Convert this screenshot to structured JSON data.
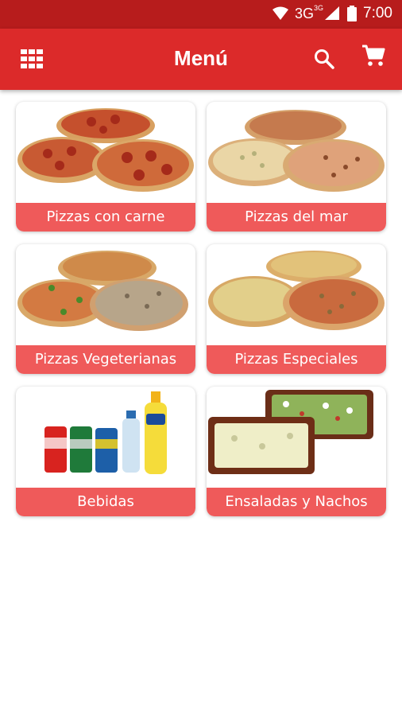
{
  "status_bar": {
    "network": "3G",
    "network_sub": "3G",
    "time": "7:00"
  },
  "app_bar": {
    "title": "Menú"
  },
  "categories": [
    {
      "label": "Pizzas con carne",
      "image": "pizzas-meat"
    },
    {
      "label": "Pizzas del mar",
      "image": "pizzas-seafood"
    },
    {
      "label": "Pizzas Vegeterianas",
      "image": "pizzas-vegetarian"
    },
    {
      "label": "Pizzas Especiales",
      "image": "pizzas-special"
    },
    {
      "label": "Bebidas",
      "image": "drinks"
    },
    {
      "label": "Ensaladas y Nachos",
      "image": "salads-nachos"
    }
  ],
  "colors": {
    "status_bar": "#b71c1c",
    "app_bar": "#dc2a2a",
    "card_label": "#ef5a5a"
  }
}
